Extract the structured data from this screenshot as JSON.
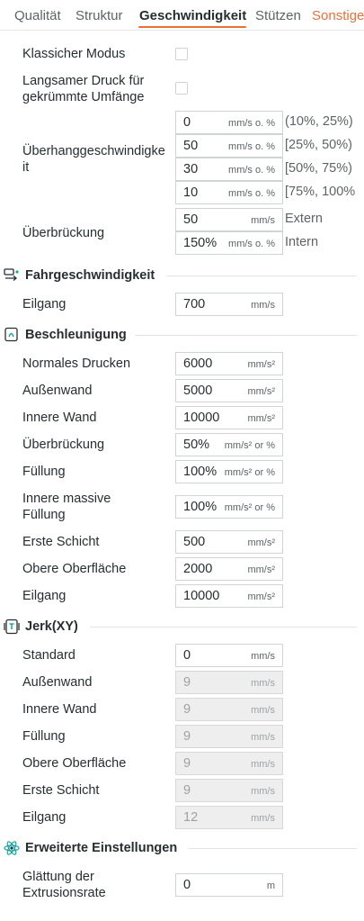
{
  "tabs": [
    {
      "label": "Qualität"
    },
    {
      "label": "Struktur"
    },
    {
      "label": "Geschwindigkeit"
    },
    {
      "label": "Stützen"
    },
    {
      "label": "Sonstige"
    }
  ],
  "classic_mode": {
    "label": "Klassicher Modus",
    "checked": false
  },
  "slow_down_curled": {
    "label": "Langsamer Druck für gekrümmte Umfänge",
    "checked": false
  },
  "overhang_speed": {
    "label": "Überhanggeschwindigkeit",
    "rows": [
      {
        "value": "0",
        "unit": "mm/s o. %",
        "range": "(10%, 25%)"
      },
      {
        "value": "50",
        "unit": "mm/s o. %",
        "range": "[25%, 50%)"
      },
      {
        "value": "30",
        "unit": "mm/s o. %",
        "range": "[50%, 75%)"
      },
      {
        "value": "10",
        "unit": "mm/s o. %",
        "range": "[75%, 100%"
      }
    ]
  },
  "bridge": {
    "label": "Überbrückung",
    "external": {
      "value": "50",
      "unit": "mm/s",
      "side": "Extern"
    },
    "internal": {
      "value": "150%",
      "unit": "mm/s o. %",
      "side": "Intern"
    }
  },
  "travel_section": {
    "title": "Fahrgeschwindigkeit",
    "icon": "travel-speed-icon",
    "travel": {
      "label": "Eilgang",
      "value": "700",
      "unit": "mm/s"
    }
  },
  "acceleration_section": {
    "title": "Beschleunigung",
    "icon": "acceleration-icon",
    "rows": [
      {
        "label": "Normales Drucken",
        "value": "6000",
        "unit": "mm/s²"
      },
      {
        "label": "Außenwand",
        "value": "5000",
        "unit": "mm/s²"
      },
      {
        "label": "Innere Wand",
        "value": "10000",
        "unit": "mm/s²"
      },
      {
        "label": "Überbrückung",
        "value": "50%",
        "unit": "mm/s² or %"
      },
      {
        "label": "Füllung",
        "value": "100%",
        "unit": "mm/s² or %"
      },
      {
        "label": "Innere massive Füllung",
        "value": "100%",
        "unit": "mm/s² or %"
      },
      {
        "label": "Erste Schicht",
        "value": "500",
        "unit": "mm/s²"
      },
      {
        "label": "Obere Oberfläche",
        "value": "2000",
        "unit": "mm/s²"
      },
      {
        "label": "Eilgang",
        "value": "10000",
        "unit": "mm/s²"
      }
    ]
  },
  "jerk_section": {
    "title": "Jerk(XY)",
    "icon": "jerk-icon",
    "rows": [
      {
        "label": "Standard",
        "value": "0",
        "unit": "mm/s",
        "enabled": true
      },
      {
        "label": "Außenwand",
        "value": "9",
        "unit": "mm/s",
        "enabled": false
      },
      {
        "label": "Innere Wand",
        "value": "9",
        "unit": "mm/s",
        "enabled": false
      },
      {
        "label": "Füllung",
        "value": "9",
        "unit": "mm/s",
        "enabled": false
      },
      {
        "label": "Obere Oberfläche",
        "value": "9",
        "unit": "mm/s",
        "enabled": false
      },
      {
        "label": "Erste Schicht",
        "value": "9",
        "unit": "mm/s",
        "enabled": false
      },
      {
        "label": "Eilgang",
        "value": "12",
        "unit": "mm/s",
        "enabled": false
      }
    ]
  },
  "advanced_section": {
    "title": "Erweiterte Einstellungen",
    "icon": "advanced-settings-icon",
    "smoothing": {
      "label": "Glättung der Extrusionsrate",
      "value": "0",
      "unit": "m"
    }
  },
  "colors": {
    "accent": "#e8703a",
    "icon": "#1aa5a0"
  }
}
